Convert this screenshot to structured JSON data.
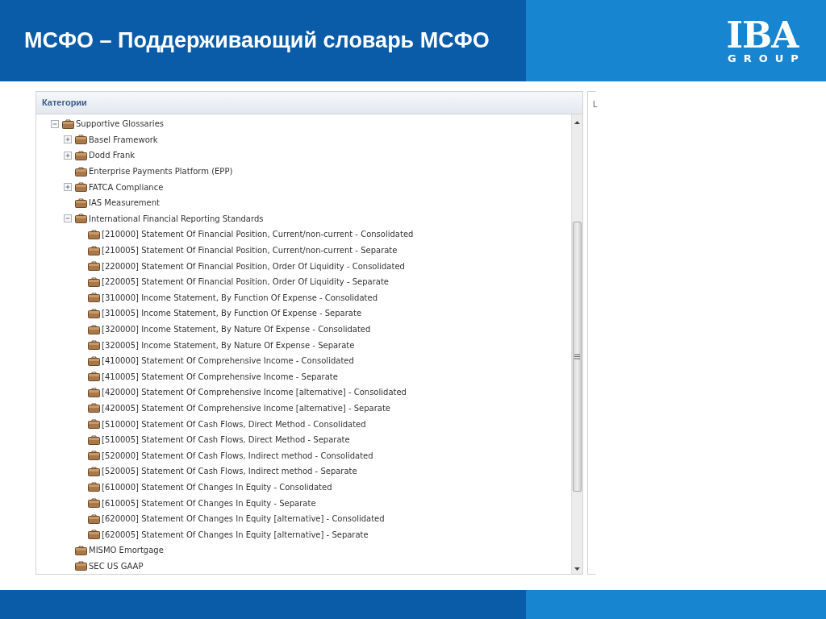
{
  "slide_title": "МСФО – Поддерживающий словарь МСФО",
  "logo": {
    "main": "IBA",
    "sub": "GROUP"
  },
  "panel": {
    "title": "Категории",
    "tree": [
      {
        "label": "Supportive Glossaries",
        "expanded": true,
        "children": [
          {
            "label": "Basel Framework",
            "expanded": false
          },
          {
            "label": "Dodd Frank",
            "expanded": false
          },
          {
            "label": "Enterprise Payments Platform (EPP)"
          },
          {
            "label": "FATCA Compliance",
            "expanded": false
          },
          {
            "label": "IAS Measurement"
          },
          {
            "label": "International Financial Reporting Standards",
            "expanded": true,
            "children": [
              {
                "label": "[210000] Statement Of Financial Position, Current/non-current - Consolidated"
              },
              {
                "label": "[210005] Statement Of Financial Position, Current/non-current - Separate"
              },
              {
                "label": "[220000] Statement Of Financial Position, Order Of Liquidity - Consolidated"
              },
              {
                "label": "[220005] Statement Of Financial Position, Order Of Liquidity - Separate"
              },
              {
                "label": "[310000] Income Statement, By Function Of Expense - Consolidated"
              },
              {
                "label": "[310005] Income Statement, By Function Of Expense - Separate"
              },
              {
                "label": "[320000] Income Statement, By Nature Of Expense - Consolidated"
              },
              {
                "label": "[320005] Income Statement, By Nature Of Expense - Separate"
              },
              {
                "label": "[410000] Statement Of Comprehensive Income - Consolidated"
              },
              {
                "label": "[410005] Statement Of Comprehensive Income - Separate"
              },
              {
                "label": "[420000] Statement Of Comprehensive Income [alternative] - Consolidated"
              },
              {
                "label": "[420005] Statement Of Comprehensive Income [alternative] - Separate"
              },
              {
                "label": "[510000] Statement Of Cash Flows, Direct Method - Consolidated"
              },
              {
                "label": "[510005] Statement Of Cash Flows, Direct Method - Separate"
              },
              {
                "label": "[520000] Statement Of Cash Flows, Indirect method - Consolidated"
              },
              {
                "label": "[520005] Statement Of Cash Flows, Indirect method - Separate"
              },
              {
                "label": "[610000] Statement Of Changes In Equity - Consolidated"
              },
              {
                "label": "[610005] Statement Of Changes In Equity - Separate"
              },
              {
                "label": "[620000] Statement Of Changes In Equity [alternative] - Consolidated"
              },
              {
                "label": "[620005] Statement Of Changes In Equity [alternative] - Separate"
              }
            ]
          },
          {
            "label": "MISMO Emortgage"
          },
          {
            "label": "SEC US GAAP"
          }
        ]
      }
    ]
  },
  "side_panel": {
    "title": "L"
  }
}
